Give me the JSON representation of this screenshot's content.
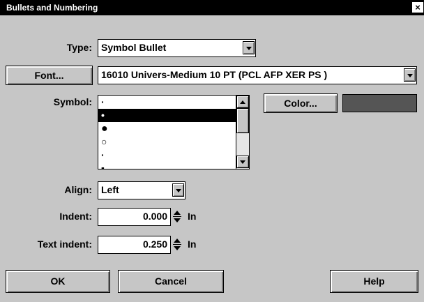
{
  "dialog": {
    "title": "Bullets and Numbering",
    "close_glyph": "×"
  },
  "type": {
    "label": "Type:",
    "value": "Symbol Bullet"
  },
  "font": {
    "button_label": "Font...",
    "value": "16010  Univers-Medium 10 PT (PCL AFP XER PS )"
  },
  "symbol": {
    "label": "Symbol:",
    "items": [
      {
        "glyph": "·",
        "icon": "tiny-dot-icon",
        "selected": false
      },
      {
        "glyph": "•",
        "icon": "small-bullet-icon",
        "selected": true
      },
      {
        "glyph": "●",
        "icon": "large-bullet-icon",
        "selected": false
      },
      {
        "glyph": "○",
        "icon": "hollow-circle-icon",
        "selected": false
      },
      {
        "glyph": "·",
        "icon": "tiny-dot-icon",
        "selected": false
      },
      {
        "glyph": "▪",
        "icon": "small-square-icon",
        "selected": false
      }
    ]
  },
  "color": {
    "button_label": "Color...",
    "swatch": "#555555"
  },
  "align": {
    "label": "Align:",
    "value": "Left"
  },
  "indent": {
    "label": "Indent:",
    "value": "0.000",
    "unit": "In"
  },
  "text_indent": {
    "label": "Text indent:",
    "value": "0.250",
    "unit": "In"
  },
  "footer": {
    "ok_label": "OK",
    "cancel_label": "Cancel",
    "help_label": "Help"
  }
}
